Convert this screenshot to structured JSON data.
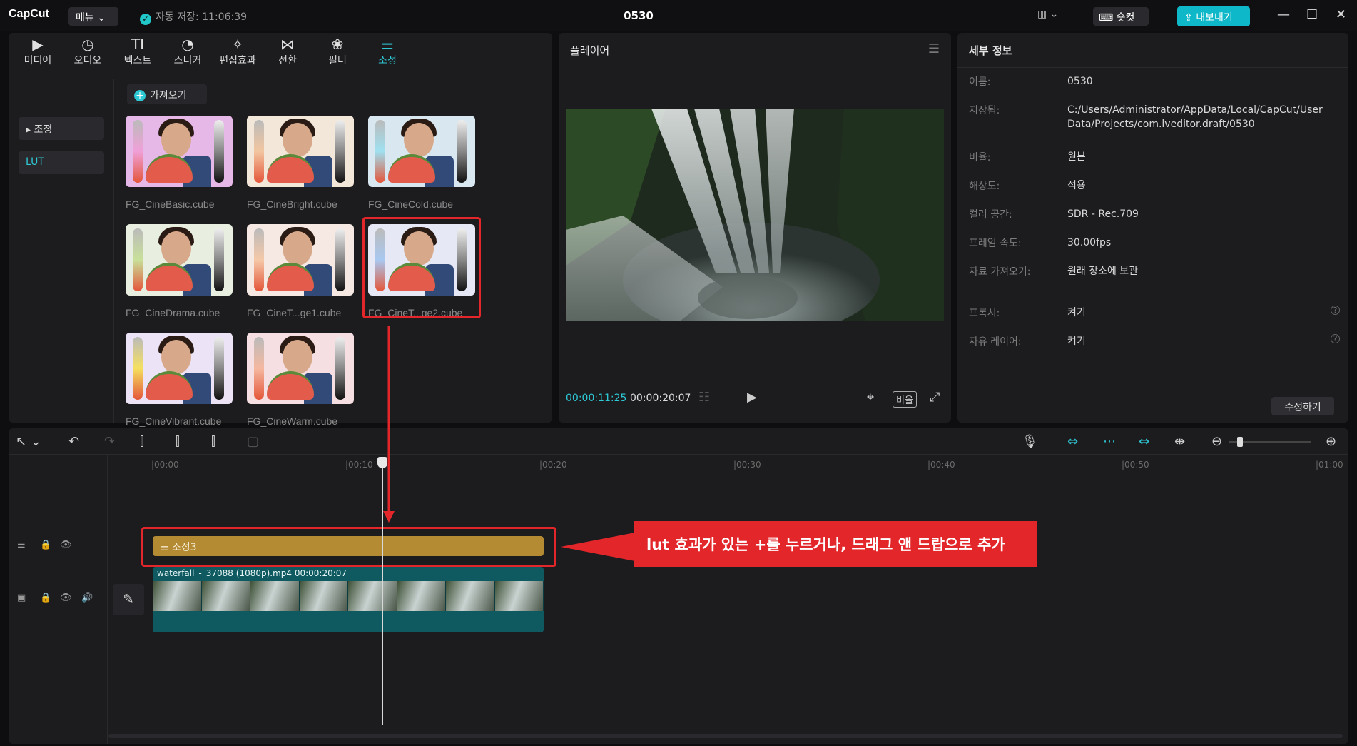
{
  "window": {
    "app_name": "CapCut",
    "menu_label": "메뉴",
    "autosave_text": "자동 저장: 11:06:39",
    "title": "0530",
    "shortcut_label": "숏컷",
    "export_label": "내보내기"
  },
  "media_toolbar": [
    {
      "label": "미디어",
      "icon": "media-icon"
    },
    {
      "label": "오디오",
      "icon": "audio-icon"
    },
    {
      "label": "텍스트",
      "icon": "text-icon"
    },
    {
      "label": "스티커",
      "icon": "sticker-icon"
    },
    {
      "label": "편집효과",
      "icon": "effects-icon"
    },
    {
      "label": "전환",
      "icon": "transition-icon"
    },
    {
      "label": "필터",
      "icon": "filter-icon"
    },
    {
      "label": "조정",
      "icon": "adjust-icon",
      "active": true
    }
  ],
  "sidebar": {
    "items": [
      {
        "label": "▸ 조정"
      },
      {
        "label": "LUT",
        "active": true
      }
    ]
  },
  "import_label": "가져오기",
  "luts": [
    {
      "name": "FG_CineBasic.cube",
      "bg": "#e6b8e8",
      "bar": "#f0a0d8"
    },
    {
      "name": "FG_CineBright.cube",
      "bg": "#f2e7d9",
      "bar": "#f2c6a0"
    },
    {
      "name": "FG_CineCold.cube",
      "bg": "#d8e7f0",
      "bar": "#9fe0f0"
    },
    {
      "name": "FG_CineDrama.cube",
      "bg": "#e8efe0",
      "bar": "#c8e09a"
    },
    {
      "name": "FG_CineT...ge1.cube",
      "bg": "#f6e8e3",
      "bar": "#f5c8a8"
    },
    {
      "name": "FG_CineT...ge2.cube",
      "bg": "#e6e8f6",
      "bar": "#a8c8f0"
    },
    {
      "name": "FG_CineVibrant.cube",
      "bg": "#ece4f6",
      "bar": "#f5e060"
    },
    {
      "name": "FG_CineWarm.cube",
      "bg": "#f6dfe3",
      "bar": "#f5b8a0"
    }
  ],
  "player": {
    "title": "플레이어",
    "current_time": "00:00:11:25",
    "total_time": "00:00:20:07",
    "ratio_label": "비율"
  },
  "details": {
    "title": "세부 정보",
    "rows": [
      {
        "label": "이름:",
        "value": "0530"
      },
      {
        "label": "저장됨:",
        "value": "C:/Users/Administrator/AppData/Local/CapCut/User Data/Projects/com.lveditor.draft/0530"
      },
      {
        "label": "비율:",
        "value": "원본"
      },
      {
        "label": "해상도:",
        "value": "적용"
      },
      {
        "label": "컬러 공간:",
        "value": "SDR - Rec.709"
      },
      {
        "label": "프레임 속도:",
        "value": "30.00fps"
      },
      {
        "label": "자료 가져오기:",
        "value": "원래 장소에 보관"
      },
      {
        "label": "프록시:",
        "value": "켜기"
      },
      {
        "label": "자유 레이어:",
        "value": "켜기"
      }
    ],
    "edit_button": "수정하기"
  },
  "timeline": {
    "ruler": [
      "|00:00",
      "|00:10",
      "|00:20",
      "|00:30",
      "|00:40",
      "|00:50",
      "|01:00"
    ],
    "adjust_clip_label": "조정3",
    "video_clip_label": "waterfall_-_37088 (1080p).mp4   00:00:20:07"
  },
  "annotation": {
    "callout_text": "lut 효과가 있는 +를 누르거나, 드래그 앤 드랍으로 추가",
    "color": "#e2262a"
  },
  "colors": {
    "accent": "#2ec8d5",
    "adjust_clip": "#b48a32",
    "video_clip": "#0f5a61"
  }
}
